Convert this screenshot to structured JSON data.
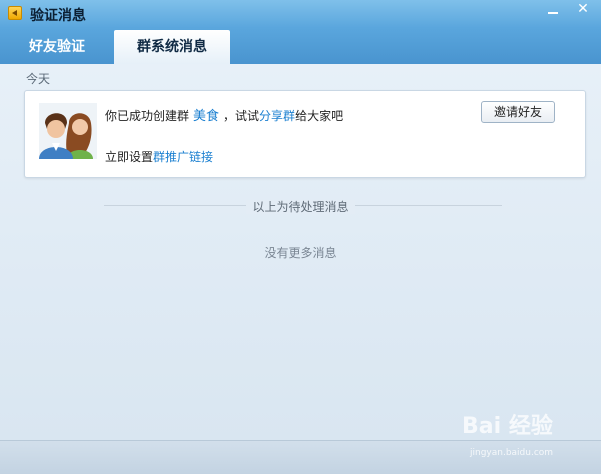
{
  "window": {
    "title": "验证消息",
    "minimize_icon": "minimize-icon",
    "close_label": "✕"
  },
  "tabs": [
    {
      "label": "好友验证",
      "active": false
    },
    {
      "label": "群系统消息",
      "active": true
    }
  ],
  "section": {
    "date_label": "今天"
  },
  "message": {
    "avatar_icon": "couple-avatar-icon",
    "part1": "你已成功创建群",
    "group_name": "美食",
    "part2": "，试试",
    "share_link": "分享群",
    "part3": "给大家吧",
    "setup_prefix": "立即设置",
    "promo_link": "群推广链接",
    "invite_button": "邀请好友"
  },
  "divider_text": "以上为待处理消息",
  "no_more_text": "没有更多消息",
  "watermark": {
    "brand": "Bai 经验",
    "url": "jingyan.baidu.com"
  },
  "colors": {
    "accent": "#1a7fd0",
    "titlebar": "#5aa6dd"
  }
}
